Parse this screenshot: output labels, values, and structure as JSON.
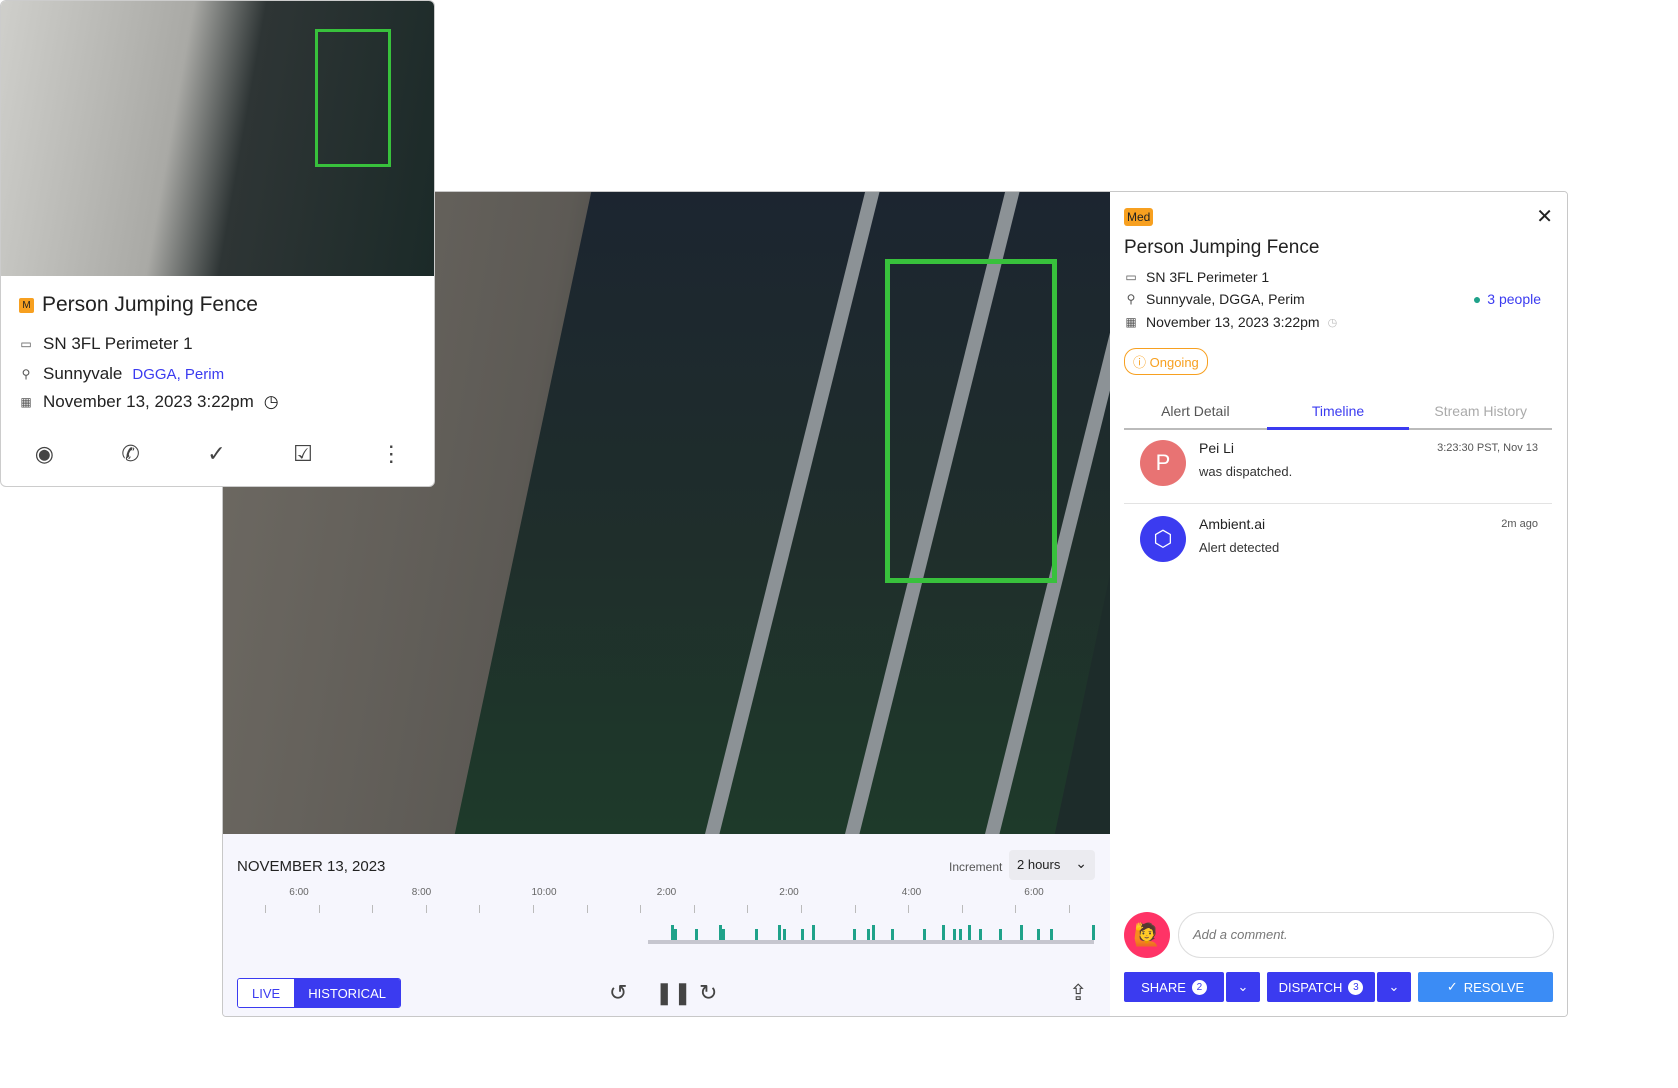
{
  "card": {
    "severity": "M",
    "title": "Person Jumping Fence",
    "camera": "SN 3FL Perimeter 1",
    "site": "Sunnyvale",
    "site_link": "DGGA, Perim",
    "datetime": "November 13, 2023 3:22pm",
    "actions": [
      {
        "icon": "eye-icon",
        "glyph": "◉"
      },
      {
        "icon": "phone-icon",
        "glyph": "✆"
      },
      {
        "icon": "check-icon",
        "glyph": "✓"
      },
      {
        "icon": "chat-check-icon",
        "glyph": "☑"
      },
      {
        "icon": "more-icon",
        "glyph": "⋮"
      }
    ]
  },
  "player": {
    "date": "NOVEMBER 13, 2023",
    "increment_label": "Increment",
    "increment_value": "2 hours",
    "tick_labels": [
      "6:00",
      "8:00",
      "10:00",
      "2:00",
      "2:00",
      "4:00",
      "6:00"
    ],
    "mode_live": "LIVE",
    "mode_historical": "HISTORICAL",
    "active_mode": "HISTORICAL"
  },
  "alert": {
    "severity": "Med",
    "title": "Person Jumping Fence",
    "camera": "SN 3FL Perimeter 1",
    "location": "Sunnyvale, DGGA, Perim",
    "datetime": "November 13, 2023 3:22pm",
    "people": "3 people",
    "status": "Ongoing",
    "tabs": [
      "Alert Detail",
      "Timeline",
      "Stream History"
    ],
    "active_tab": "Timeline",
    "timeline": [
      {
        "initial": "P",
        "name": "Pei Li",
        "desc": "was dispatched.",
        "time": "3:23:30 PST, Nov 13",
        "color": "#e87373"
      },
      {
        "initial": "⬡",
        "name": "Ambient.ai",
        "desc": "Alert detected",
        "time": "2m ago",
        "color": "#3b3bf0"
      }
    ],
    "comment_placeholder": "Add a comment.",
    "share_label": "SHARE",
    "share_count": "2",
    "dispatch_label": "DISPATCH",
    "dispatch_count": "3",
    "resolve_label": "RESOLVE"
  },
  "colors": {
    "accent": "#3b3bf0",
    "severity": "#f7a020",
    "event": "#1fa28a",
    "bbox": "#38c13c"
  }
}
